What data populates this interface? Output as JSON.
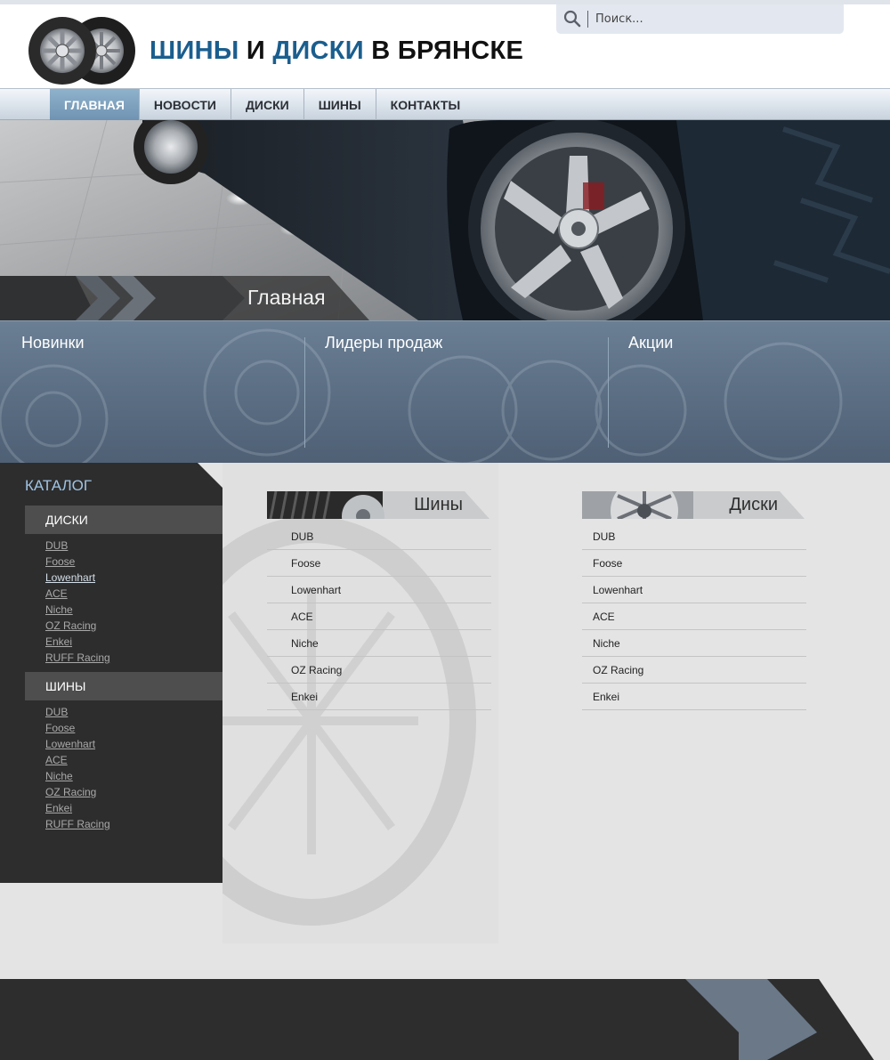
{
  "header": {
    "title_part1": "ШИНЫ",
    "title_part2": " И ",
    "title_part3": "ДИСКИ",
    "title_part4": " В БРЯНСКЕ",
    "search_placeholder": "Поиск..."
  },
  "nav": {
    "items": [
      "ГЛАВНАЯ",
      "НОВОСТИ",
      "ДИСКИ",
      "ШИНЫ",
      "КОНТАКТЫ"
    ],
    "active_index": 0
  },
  "banner": {
    "title": "Главная"
  },
  "features": [
    "Новинки",
    "Лидеры продаж",
    "Акции"
  ],
  "sidebar": {
    "title": "КАТАЛОГ",
    "groups": [
      {
        "title": "ДИСКИ",
        "items": [
          "DUB",
          "Foose",
          "Lowenhart",
          "ACE",
          "Niche",
          "OZ Racing",
          "Enkei",
          "RUFF Racing"
        ]
      },
      {
        "title": "ШИНЫ",
        "items": [
          "DUB",
          "Foose",
          "Lowenhart",
          "ACE",
          "Niche",
          "OZ Racing",
          "Enkei",
          "RUFF Racing"
        ]
      }
    ]
  },
  "blocks": [
    {
      "title": "Шины",
      "items": [
        "DUB",
        "Foose",
        "Lowenhart",
        "ACE",
        "Niche",
        "OZ Racing",
        "Enkei"
      ]
    },
    {
      "title": "Диски",
      "items": [
        "DUB",
        "Foose",
        "Lowenhart",
        "ACE",
        "Niche",
        "OZ Racing",
        "Enkei"
      ]
    }
  ],
  "colors": {
    "accent_blue": "#1a5e8e",
    "nav_active": "#7fa3c0",
    "sidebar_bg": "#2d2d2d",
    "feature_bg": "#5a6d82"
  },
  "icons": {
    "search": "magnifier-icon",
    "logo": "tires-logo-icon"
  }
}
